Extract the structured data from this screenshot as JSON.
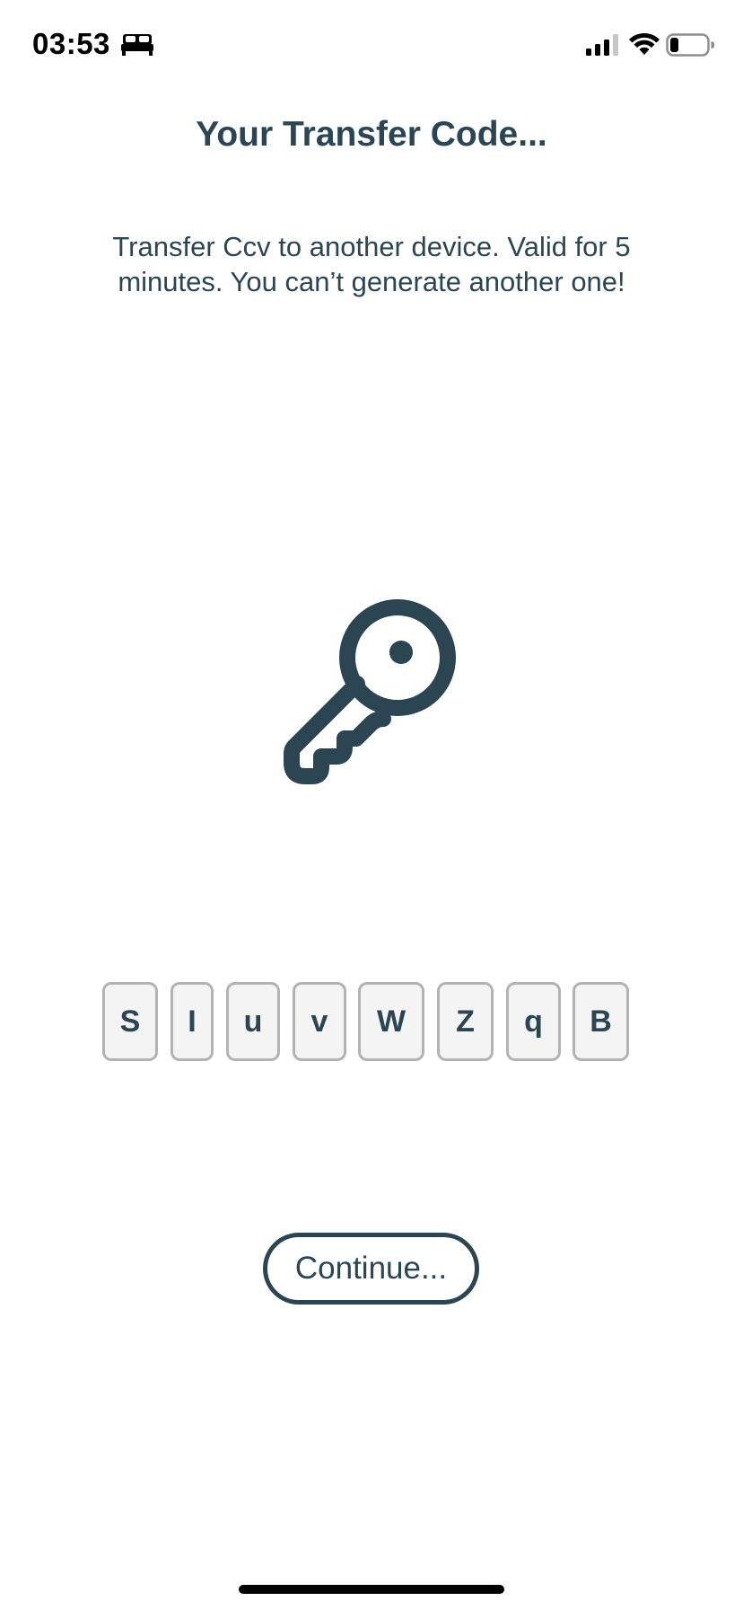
{
  "status_bar": {
    "time": "03:53",
    "icons": [
      "bed-icon",
      "signal-icon",
      "wifi-icon",
      "battery-icon"
    ]
  },
  "screen": {
    "title": "Your Transfer Code...",
    "description": "Transfer Ccv to another device. Valid for 5 minutes. You can’t generate another one!",
    "illustration": "key-icon",
    "code": [
      "S",
      "I",
      "u",
      "v",
      "W",
      "Z",
      "q",
      "B"
    ],
    "continue_label": "Continue..."
  },
  "colors": {
    "primary": "#2c4552",
    "code_box_border": "#b3b3b3",
    "code_box_background": "#f4f4f4"
  }
}
